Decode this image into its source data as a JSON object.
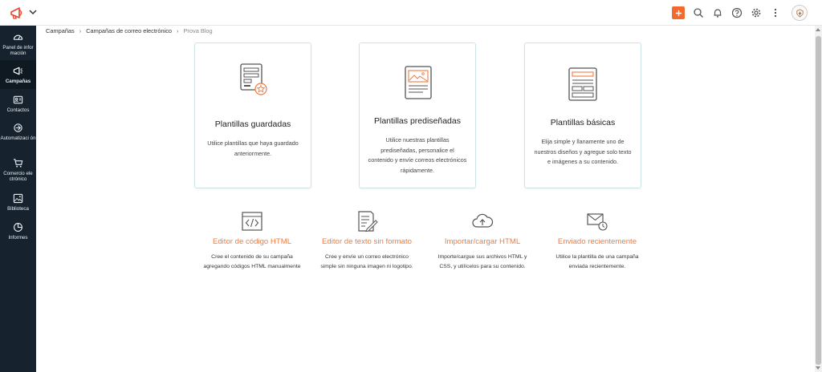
{
  "sidebar": {
    "items": [
      {
        "label": "Panel de infor mación",
        "icon": "dashboard-icon"
      },
      {
        "label": "Campañas",
        "icon": "megaphone-icon"
      },
      {
        "label": "Contactos",
        "icon": "contact-card-icon"
      },
      {
        "label": "Automatizaci ón",
        "icon": "automation-icon"
      },
      {
        "label": "Comercio ele ctrónico",
        "icon": "cart-icon"
      },
      {
        "label": "Biblioteca",
        "icon": "library-icon"
      },
      {
        "label": "Informes",
        "icon": "pie-chart-icon"
      }
    ]
  },
  "breadcrumb": {
    "items": [
      "Campañas",
      "Campañas de correo electrónico",
      "Prova Blog"
    ]
  },
  "cards": [
    {
      "title": "Plantillas guardadas",
      "desc": "Utilice plantillas que haya guardado anteriormente.",
      "icon": "saved-template-icon"
    },
    {
      "title": "Plantillas prediseñadas",
      "desc": "Utilice nuestras plantillas prediseñadas, personalice el contenido y envíe correos electrónicos rápidamente.",
      "icon": "predesigned-template-icon"
    },
    {
      "title": "Plantillas básicas",
      "desc": "Elija simple y llanamente uno de nuestros diseños y agregue solo texto e imágenes a su contenido.",
      "icon": "basic-template-icon"
    }
  ],
  "options": [
    {
      "title": "Editor de código HTML",
      "desc": "Cree el contenido de su campaña agregando códigos HTML manualmente",
      "icon": "html-code-icon"
    },
    {
      "title": "Editor de texto sin formato",
      "desc": "Cree y envíe un correo electrónico simple sin ninguna imagen ni logotipo.",
      "icon": "plain-text-icon"
    },
    {
      "title": "Importar/cargar HTML",
      "desc": "Importe/cargue sus archivos HTML y CSS, y utilícelos para su contenido.",
      "icon": "cloud-upload-icon"
    },
    {
      "title": "Enviado recientemente",
      "desc": "Utilice la plantilla de una campaña enviada recientemente.",
      "icon": "recent-mail-icon"
    }
  ],
  "colors": {
    "accent": "#f26a2e",
    "sidebar_bg": "#16232f",
    "option_title": "#f07b3f"
  }
}
